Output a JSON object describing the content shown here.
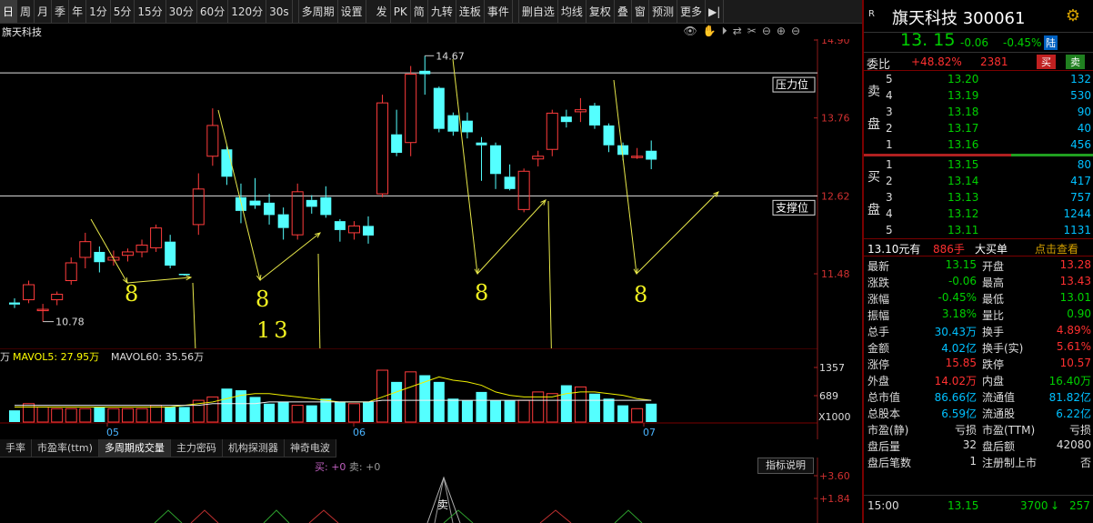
{
  "toolbar": {
    "left_items": [
      "日",
      "周",
      "月",
      "季",
      "年",
      "1分",
      "5分",
      "15分",
      "30分",
      "60分",
      "120分",
      "30s",
      "",
      "多周期",
      "设置"
    ],
    "right_items": [
      "发",
      "PK",
      "简",
      "九转",
      "连板",
      "事件",
      "",
      "删自选",
      "均线",
      "复权",
      "叠",
      "窗",
      "预测",
      "更多",
      "▶|"
    ]
  },
  "title": {
    "stock_name": "旗天科技"
  },
  "chart_tools": [
    "👁",
    "✋",
    "⏵",
    "⇄",
    "✂",
    "⊖",
    "⊕",
    "⊖"
  ],
  "price_chart": {
    "y_ticks": [
      "14.90",
      "13.76",
      "12.62",
      "11.48"
    ],
    "resistance_label": "压力位",
    "support_label": "支撑位",
    "high_label": "14.67",
    "low_label": "10.78",
    "annotations": [
      "8",
      "8",
      "8",
      "8",
      "13"
    ]
  },
  "volume_chart": {
    "legend": {
      "unit": "万",
      "mavol5": "MAVOL5: 27.95万",
      "mavol60": "MAVOL60: 35.56万"
    },
    "y_ticks": [
      "1357",
      "689"
    ],
    "scale": "X1000",
    "x_ticks": [
      "05",
      "06",
      "07"
    ]
  },
  "indicator": {
    "tabs": [
      "手率",
      "市盈率(ttm)",
      "多周期成交量",
      "主力密码",
      "机构探测器",
      "神奇电波"
    ],
    "active_tab": 2,
    "explain_button": "指标说明",
    "buy_legend": "买: +0",
    "sell_legend": "卖: +0",
    "sell_mark": "卖",
    "y_ticks": [
      "+3.60",
      "+1.84"
    ]
  },
  "quote": {
    "badge": "R",
    "name_code": "旗天科技 300061",
    "price": "13. 15",
    "change": "-0.06",
    "change_pct": "-0.45%",
    "board": "陆",
    "ratio_label": "委比",
    "ratio_value": "+48.82%",
    "ratio_diff": "2381",
    "buy_btn": "买",
    "sell_btn": "卖",
    "sell_side_label": "卖\n\n盘",
    "buy_side_label": "买\n\n盘",
    "asks": [
      {
        "lv": "5",
        "px": "13.20",
        "vol": "132"
      },
      {
        "lv": "4",
        "px": "13.19",
        "vol": "530"
      },
      {
        "lv": "3",
        "px": "13.18",
        "vol": "90"
      },
      {
        "lv": "2",
        "px": "13.17",
        "vol": "40"
      },
      {
        "lv": "1",
        "px": "13.16",
        "vol": "456"
      }
    ],
    "bids": [
      {
        "lv": "1",
        "px": "13.15",
        "vol": "80"
      },
      {
        "lv": "2",
        "px": "13.14",
        "vol": "417"
      },
      {
        "lv": "3",
        "px": "13.13",
        "vol": "757"
      },
      {
        "lv": "4",
        "px": "13.12",
        "vol": "1244"
      },
      {
        "lv": "5",
        "px": "13.11",
        "vol": "1131"
      }
    ],
    "big_order": {
      "price": "13.10元有",
      "qty": "886手",
      "label": "大买单",
      "link": "点击查看"
    },
    "stats": [
      [
        "最新",
        "13.15",
        "开盘",
        "13.28"
      ],
      [
        "涨跌",
        "-0.06",
        "最高",
        "13.43"
      ],
      [
        "涨幅",
        "-0.45%",
        "最低",
        "13.01"
      ],
      [
        "振幅",
        "3.18%",
        "量比",
        "0.90"
      ],
      [
        "总手",
        "30.43万",
        "换手",
        "4.89%"
      ],
      [
        "金额",
        "4.02亿",
        "换手(实)",
        "5.61%"
      ],
      [
        "涨停",
        "15.85",
        "跌停",
        "10.57"
      ],
      [
        "外盘",
        "14.02万",
        "内盘",
        "16.40万"
      ],
      [
        "总市值",
        "86.66亿",
        "流通值",
        "81.82亿"
      ],
      [
        "总股本",
        "6.59亿",
        "流通股",
        "6.22亿"
      ],
      [
        "市盈(静)",
        "亏损",
        "市盈(TTM)",
        "亏损"
      ],
      [
        "盘后量",
        "32",
        "盘后额",
        "42080"
      ],
      [
        "盘后笔数",
        "1",
        "注册制上市",
        "否"
      ]
    ],
    "footer": {
      "time": "15:00",
      "price": "13.15",
      "vol": "3700",
      "arrow": "↓",
      "count": "257"
    }
  },
  "chart_data": {
    "type": "candlestick",
    "price_ticks": [
      14.9,
      13.76,
      12.62,
      11.48
    ],
    "candles": [
      [
        11.06,
        11.12,
        10.98,
        11.03
      ],
      [
        11.1,
        11.38,
        11.05,
        11.32
      ],
      [
        10.96,
        11.04,
        10.78,
        10.96
      ],
      [
        11.1,
        11.22,
        11.02,
        11.18
      ],
      [
        11.38,
        11.72,
        11.32,
        11.64
      ],
      [
        11.72,
        12.08,
        11.56,
        11.95
      ],
      [
        11.8,
        11.88,
        11.5,
        11.65
      ],
      [
        11.68,
        11.82,
        11.6,
        11.72
      ],
      [
        11.75,
        11.85,
        11.66,
        11.8
      ],
      [
        11.8,
        11.98,
        11.72,
        11.9
      ],
      [
        11.86,
        12.2,
        11.8,
        12.15
      ],
      [
        11.95,
        12.05,
        11.56,
        11.6
      ],
      [
        11.48,
        11.48,
        11.45,
        11.47
      ],
      [
        12.2,
        12.95,
        12.05,
        12.72
      ],
      [
        13.2,
        13.9,
        13.06,
        13.65
      ],
      [
        13.3,
        13.35,
        12.78,
        12.9
      ],
      [
        12.6,
        12.8,
        12.22,
        12.4
      ],
      [
        12.55,
        12.88,
        12.43,
        12.48
      ],
      [
        12.52,
        12.65,
        12.2,
        12.34
      ],
      [
        12.35,
        12.45,
        11.98,
        12.15
      ],
      [
        12.05,
        12.8,
        11.98,
        12.68
      ],
      [
        12.56,
        12.63,
        12.36,
        12.46
      ],
      [
        12.6,
        12.76,
        12.3,
        12.34
      ],
      [
        12.25,
        12.28,
        11.95,
        12.12
      ],
      [
        12.08,
        12.25,
        11.98,
        12.18
      ],
      [
        12.18,
        12.32,
        11.92,
        12.04
      ],
      [
        12.65,
        14.1,
        12.6,
        13.98
      ],
      [
        13.52,
        13.88,
        13.2,
        13.25
      ],
      [
        13.4,
        14.52,
        13.2,
        14.4
      ],
      [
        14.45,
        14.67,
        14.1,
        14.4
      ],
      [
        14.2,
        14.22,
        13.55,
        13.6
      ],
      [
        13.8,
        13.84,
        13.5,
        13.56
      ],
      [
        13.72,
        13.84,
        13.46,
        13.55
      ],
      [
        13.4,
        13.48,
        12.84,
        13.36
      ],
      [
        13.36,
        13.4,
        12.72,
        12.94
      ],
      [
        12.9,
        13.08,
        12.7,
        12.72
      ],
      [
        12.42,
        13.02,
        12.38,
        12.98
      ],
      [
        13.16,
        13.28,
        13.05,
        13.2
      ],
      [
        13.3,
        13.88,
        13.2,
        13.83
      ],
      [
        13.78,
        13.88,
        13.62,
        13.7
      ],
      [
        13.85,
        14.05,
        13.7,
        13.88
      ],
      [
        13.94,
        13.98,
        13.6,
        13.65
      ],
      [
        13.65,
        13.68,
        13.26,
        13.36
      ],
      [
        13.36,
        13.4,
        13.14,
        13.22
      ],
      [
        13.2,
        13.32,
        13.16,
        13.2
      ],
      [
        13.28,
        13.43,
        13.01,
        13.15
      ]
    ],
    "volumes": [
      7,
      11,
      9,
      8,
      8,
      8,
      9,
      8,
      8,
      8,
      10,
      9,
      9,
      13,
      15,
      20,
      19,
      15,
      11,
      12,
      10,
      10,
      14,
      12,
      11,
      12,
      31,
      24,
      30,
      28,
      24,
      14,
      13,
      18,
      13,
      13,
      13,
      18,
      17,
      22,
      21,
      17,
      14,
      10,
      8,
      11
    ],
    "mavol5": [
      9,
      9,
      9,
      9,
      9,
      9,
      9,
      9,
      9,
      9,
      9,
      9,
      10,
      11,
      12,
      14,
      16,
      17,
      17,
      16,
      15,
      14,
      13,
      12,
      12,
      12,
      15,
      18,
      21,
      24,
      27,
      25,
      24,
      22,
      18,
      16,
      15,
      15,
      15,
      17,
      18,
      18,
      17,
      16,
      14,
      13
    ],
    "mavol60": [
      10,
      10,
      10,
      10,
      10,
      10,
      10,
      10,
      10,
      10,
      10,
      10,
      10,
      10,
      11,
      11,
      11,
      11,
      12,
      12,
      12,
      12,
      12,
      12,
      12,
      12,
      13,
      13,
      13,
      13,
      13,
      13,
      13,
      13,
      13,
      13,
      13,
      13,
      13,
      13,
      13,
      13,
      13,
      13,
      13,
      13
    ]
  }
}
